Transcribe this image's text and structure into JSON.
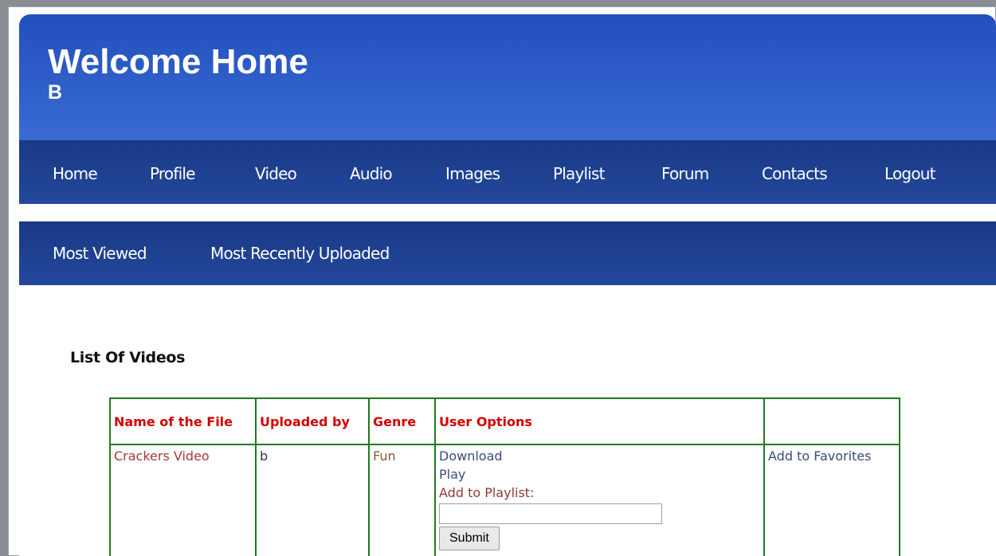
{
  "header": {
    "title": "Welcome Home",
    "user": "B"
  },
  "nav": [
    {
      "label": "Home"
    },
    {
      "label": "Profile"
    },
    {
      "label": "Video"
    },
    {
      "label": "Audio"
    },
    {
      "label": "Images"
    },
    {
      "label": "Playlist"
    },
    {
      "label": "Forum"
    },
    {
      "label": "Contacts"
    },
    {
      "label": "Logout"
    }
  ],
  "subnav": [
    {
      "label": "Most Viewed"
    },
    {
      "label": "Most Recently Uploaded"
    }
  ],
  "section": {
    "title": "List Of Videos"
  },
  "table": {
    "headers": [
      "Name of the File",
      "Uploaded by",
      "Genre",
      "User Options",
      ""
    ],
    "rows": [
      {
        "name": "Crackers Video",
        "uploaded_by": "b",
        "genre": "Fun",
        "download": "Download",
        "play": "Play",
        "add_to_playlist": "Add to Playlist:",
        "playlist_value": "",
        "submit": "Submit",
        "favorite": "Add to Favorites"
      }
    ]
  },
  "colors": {
    "banner": "#2f5fce",
    "nav": "#1f4190",
    "header_text": "#d40000",
    "table_border": "#1f7a1f"
  }
}
